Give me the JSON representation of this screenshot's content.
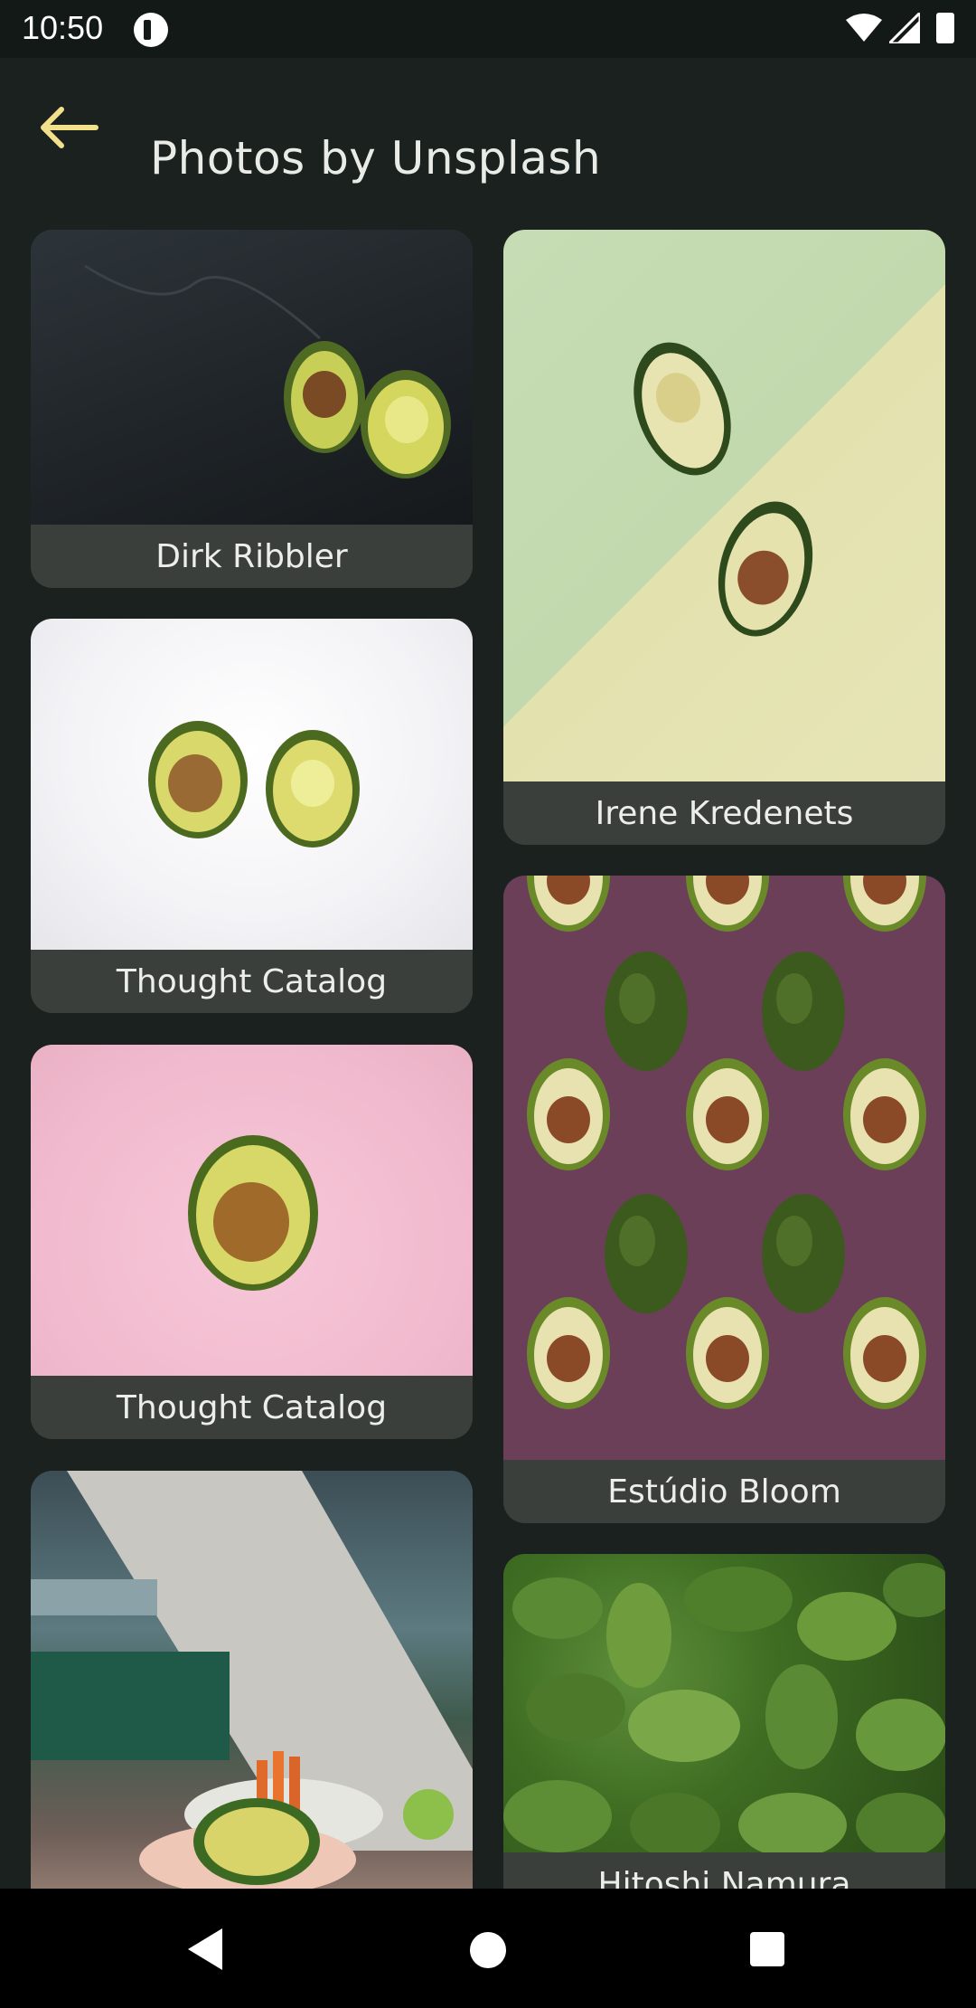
{
  "status_bar": {
    "time": "10:50"
  },
  "app_bar": {
    "title": "Photos by Unsplash"
  },
  "photos": [
    {
      "credit": "Dirk Ribbler"
    },
    {
      "credit": "Irene Kredenets"
    },
    {
      "credit": "Thought Catalog"
    },
    {
      "credit": "Estúdio Bloom"
    },
    {
      "credit": "Thought Catalog"
    },
    {
      "credit": "Hitoshi Namura"
    },
    {
      "credit": ""
    }
  ],
  "colors": {
    "background": "#1a211e",
    "accent": "#f3e08a",
    "caption_bg": "#3b3f3c"
  },
  "icons": {
    "back": "arrow-left-icon",
    "nav_back": "triangle-back-icon",
    "nav_home": "circle-home-icon",
    "nav_recents": "square-recents-icon"
  }
}
